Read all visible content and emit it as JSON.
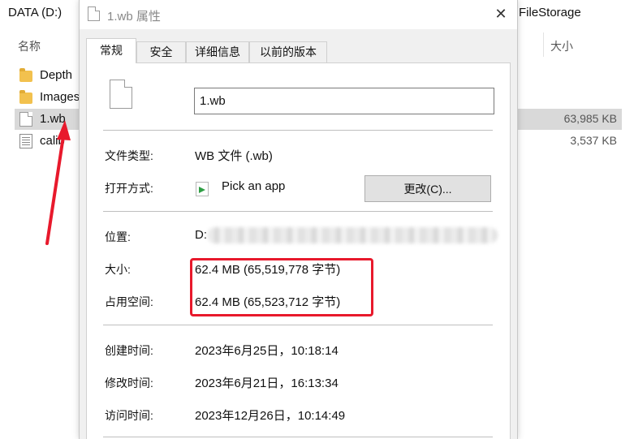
{
  "explorer": {
    "drive_title": "DATA (D:)",
    "folder_title": "FileStorage",
    "columns": {
      "name": "名称",
      "size": "大小"
    },
    "rows": [
      {
        "name": "Depth",
        "size": "",
        "icon": "folder-icon",
        "selected": false
      },
      {
        "name": "Images",
        "size": "",
        "icon": "folder-icon",
        "selected": false
      },
      {
        "name": "1.wb",
        "size": "63,985 KB",
        "icon": "file-icon",
        "selected": true
      },
      {
        "name": "calib",
        "size": "3,537 KB",
        "icon": "exe-icon",
        "selected": false
      }
    ]
  },
  "dialog": {
    "title": "1.wb 属性",
    "close_glyph": "✕",
    "tabs": [
      "常规",
      "安全",
      "详细信息",
      "以前的版本"
    ],
    "active_tab": 0,
    "file_name": "1.wb",
    "fields": {
      "type_label": "文件类型:",
      "type_value": "WB 文件 (.wb)",
      "open_label": "打开方式:",
      "open_value": "Pick an app",
      "change_button": "更改(C)...",
      "location_label": "位置:",
      "location_value": "D:",
      "size_label": "大小:",
      "size_value": "62.4 MB (65,519,778 字节)",
      "disk_label": "占用空间:",
      "disk_value": "62.4 MB (65,523,712 字节)",
      "created_label": "创建时间:",
      "created_value": "2023年6月25日，10:18:14",
      "modified_label": "修改时间:",
      "modified_value": "2023年6月21日，16:13:34",
      "accessed_label": "访问时间:",
      "accessed_value": "2023年12月26日，10:14:49"
    }
  },
  "annotation_color": "#e8192c"
}
